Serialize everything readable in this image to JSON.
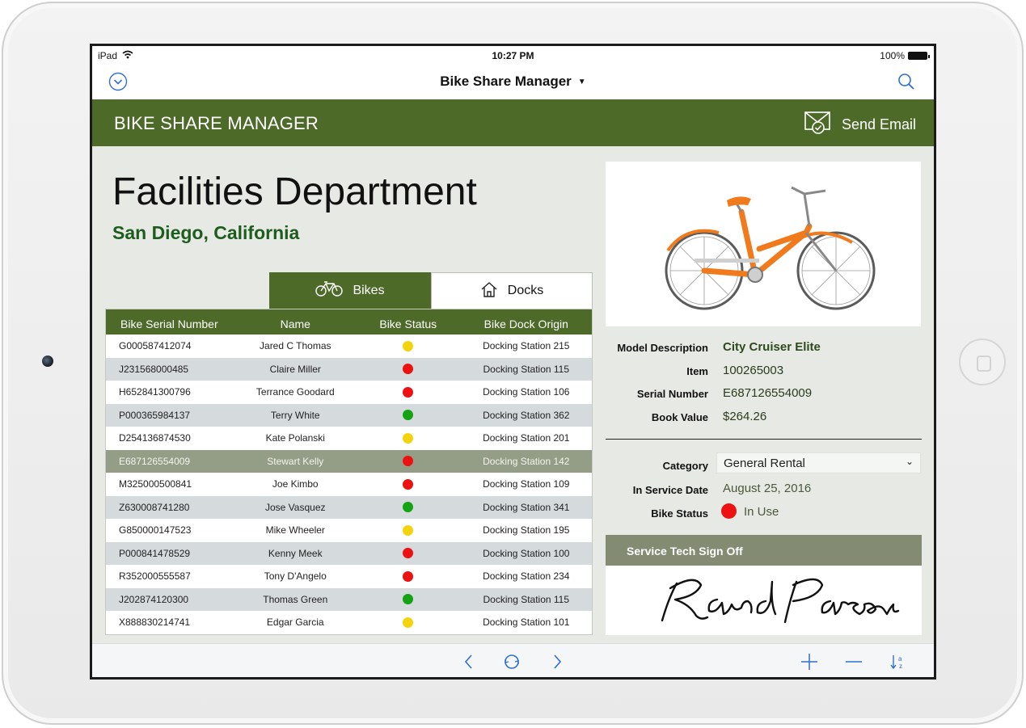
{
  "statusbar": {
    "carrier": "iPad",
    "time": "10:27 PM",
    "battery": "100%"
  },
  "navbar": {
    "title": "Bike Share Manager",
    "left_icon": "chevron-down-circle-icon",
    "right_icon": "search-icon"
  },
  "header": {
    "title": "BIKE SHARE MANAGER",
    "send_email": "Send Email"
  },
  "department": {
    "name": "Facilities Department",
    "location": "San Diego, California"
  },
  "tabs": [
    {
      "label": "Bikes",
      "icon": "bicycle-icon"
    },
    {
      "label": "Docks",
      "icon": "house-icon"
    }
  ],
  "table": {
    "columns": [
      "Bike Serial Number",
      "Name",
      "Bike Status",
      "Bike Dock Origin"
    ],
    "rows": [
      {
        "serial": "G000587412074",
        "name": "Jared C Thomas",
        "status": "yellow",
        "dock": "Docking Station 215"
      },
      {
        "serial": "J231568000485",
        "name": "Claire Miller",
        "status": "red",
        "dock": "Docking Station 115"
      },
      {
        "serial": "H652841300796",
        "name": "Terrance Goodard",
        "status": "red",
        "dock": "Docking Station 106"
      },
      {
        "serial": "P000365984137",
        "name": "Terry White",
        "status": "green",
        "dock": "Docking Station 362"
      },
      {
        "serial": "D254136874530",
        "name": "Kate Polanski",
        "status": "yellow",
        "dock": "Docking Station 201"
      },
      {
        "serial": "E687126554009",
        "name": "Stewart Kelly",
        "status": "red",
        "dock": "Docking Station 142",
        "selected": true
      },
      {
        "serial": "M325000500841",
        "name": "Joe Kimbo",
        "status": "red",
        "dock": "Docking Station 109"
      },
      {
        "serial": "Z630008741280",
        "name": "Jose Vasquez",
        "status": "green",
        "dock": "Docking Station 341"
      },
      {
        "serial": "G850000147523",
        "name": "Mike Wheeler",
        "status": "yellow",
        "dock": "Docking Station 195"
      },
      {
        "serial": "P000841478529",
        "name": "Kenny Meek",
        "status": "red",
        "dock": "Docking Station 100"
      },
      {
        "serial": "R352000555587",
        "name": "Tony D'Angelo",
        "status": "red",
        "dock": "Docking Station 234"
      },
      {
        "serial": "J202874120300",
        "name": "Thomas Green",
        "status": "green",
        "dock": "Docking Station 115"
      },
      {
        "serial": "X888830214741",
        "name": "Edgar Garcia",
        "status": "yellow",
        "dock": "Docking Station 101"
      }
    ]
  },
  "status_colors": {
    "red": "#ee1111",
    "yellow": "#f3d40c",
    "green": "#13a313"
  },
  "details": {
    "model_label": "Model Description",
    "model_value": "City Cruiser Elite",
    "item_label": "Item",
    "item_value": "100265003",
    "serial_label": "Serial Number",
    "serial_value": "E687126554009",
    "book_label": "Book Value",
    "book_value": "$264.26",
    "category_label": "Category",
    "category_value": "General Rental",
    "service_label": "In Service Date",
    "service_value": "August 25, 2016",
    "status_label": "Bike Status",
    "status_value": "In Use"
  },
  "signoff": {
    "title": "Service Tech Sign Off",
    "signature": "Rand Parsons"
  },
  "toolbar": {
    "icons": [
      "back-arrow-icon",
      "refresh-icon",
      "forward-arrow-icon",
      "plus-icon",
      "minus-icon",
      "sort-icon"
    ]
  },
  "colors": {
    "brand_green": "#4d6a29",
    "ios_blue": "#2f6fd0"
  }
}
